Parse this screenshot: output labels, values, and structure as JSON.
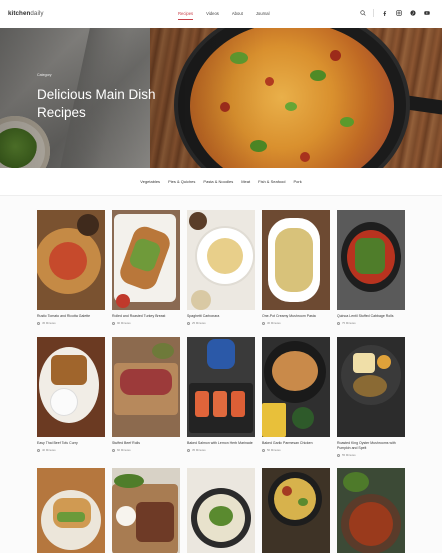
{
  "header": {
    "logo_bold": "kitchen",
    "logo_light": "daily",
    "nav": [
      {
        "label": "Recipes",
        "active": true
      },
      {
        "label": "Videos",
        "active": false
      },
      {
        "label": "About",
        "active": false
      },
      {
        "label": "Journal",
        "active": false
      }
    ],
    "icons": [
      "search-icon",
      "facebook-icon",
      "instagram-icon",
      "pinterest-icon",
      "youtube-icon"
    ]
  },
  "hero": {
    "category": "Category",
    "title": "Delicious Main Dish Recipes"
  },
  "categories": [
    "Vegetables",
    "Pies & Quiches",
    "Pasta & Noodles",
    "Meat",
    "Fish & Seafood",
    "Pork"
  ],
  "recipes": [
    {
      "title": "Rustic Tomato and Ricotta Galette",
      "time": "45 Minutes"
    },
    {
      "title": "Rolled and Roasted Turkey Breast",
      "time": "90 Minutes"
    },
    {
      "title": "Spaghetti Carbonara",
      "time": "25 Minutes"
    },
    {
      "title": "One-Pot Creamy Mushroom Pasta",
      "time": "30 Minutes"
    },
    {
      "title": "Quinoa Lentil Stuffed Cabbage Rolls",
      "time": "75 Minutes"
    },
    {
      "title": "Easy Thai Beef Tofu Curry",
      "time": "40 Minutes"
    },
    {
      "title": "Stuffed Beef Rolls",
      "time": "60 Minutes"
    },
    {
      "title": "Baked Salmon with Lemon Herb Marinade",
      "time": "35 Minutes"
    },
    {
      "title": "Baked Garlic Parmesan Chicken",
      "time": "50 Minutes"
    },
    {
      "title": "Roasted King Oyster Mushrooms with Pumpkin and Spelt",
      "time": "55 Minutes"
    },
    {
      "title": "",
      "time": ""
    },
    {
      "title": "",
      "time": ""
    },
    {
      "title": "",
      "time": ""
    },
    {
      "title": "",
      "time": ""
    },
    {
      "title": "",
      "time": ""
    }
  ],
  "colors": {
    "accent": "#c9404a",
    "text": "#222222",
    "muted": "#888888"
  }
}
